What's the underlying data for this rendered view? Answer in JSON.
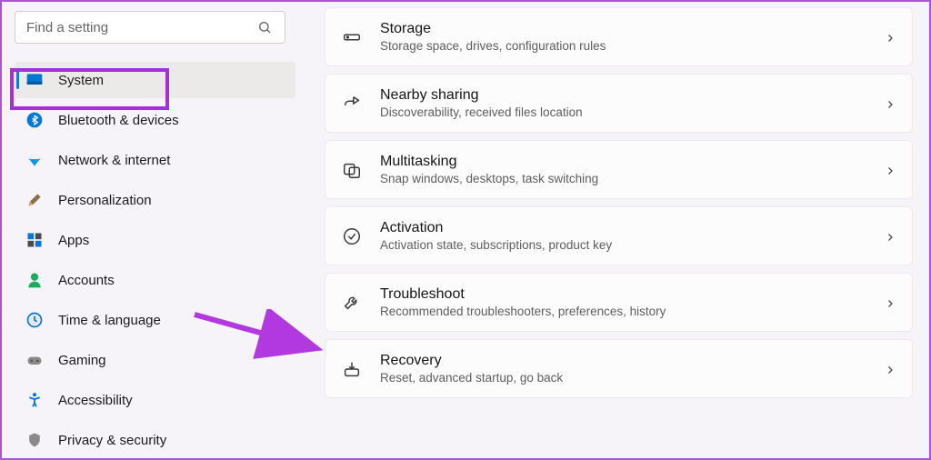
{
  "search": {
    "placeholder": "Find a setting"
  },
  "sidebar": {
    "items": [
      {
        "label": "System"
      },
      {
        "label": "Bluetooth & devices"
      },
      {
        "label": "Network & internet"
      },
      {
        "label": "Personalization"
      },
      {
        "label": "Apps"
      },
      {
        "label": "Accounts"
      },
      {
        "label": "Time & language"
      },
      {
        "label": "Gaming"
      },
      {
        "label": "Accessibility"
      },
      {
        "label": "Privacy & security"
      }
    ]
  },
  "cards": [
    {
      "title": "Storage",
      "desc": "Storage space, drives, configuration rules"
    },
    {
      "title": "Nearby sharing",
      "desc": "Discoverability, received files location"
    },
    {
      "title": "Multitasking",
      "desc": "Snap windows, desktops, task switching"
    },
    {
      "title": "Activation",
      "desc": "Activation state, subscriptions, product key"
    },
    {
      "title": "Troubleshoot",
      "desc": "Recommended troubleshooters, preferences, history"
    },
    {
      "title": "Recovery",
      "desc": "Reset, advanced startup, go back"
    }
  ],
  "annotation": {
    "highlight_target": "System",
    "arrow_target": "Troubleshoot",
    "color": "#a62fd9"
  }
}
